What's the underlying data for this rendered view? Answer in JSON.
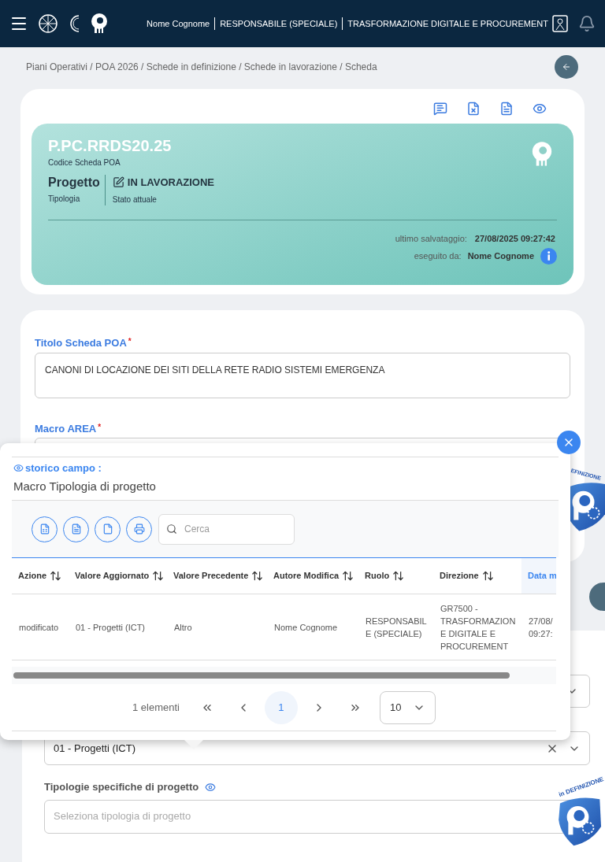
{
  "header": {
    "user": "Nome Cognome",
    "role": "RESPONSABILE (SPECIALE)",
    "department": "TRASFORMAZIONE DIGITALE E PROCUREMENT"
  },
  "breadcrumb": "Piani Operativi / POA 2026 / Schede in definizione / Schede in lavorazione / Scheda",
  "summary": {
    "code": "P.PC.RRDS20.25",
    "code_label": "Codice Scheda POA",
    "type": "Progetto",
    "type_label": "Tipologia",
    "status": "IN LAVORAZIONE",
    "status_label": "Stato attuale",
    "saved_label": "ultimo salvataggio:",
    "saved_value": "27/08/2025 09:27:42",
    "by_label": "eseguito da:",
    "by_value": "Nome Cognome"
  },
  "form": {
    "title_field": {
      "label": "Titolo Scheda POA",
      "required_mark": "*",
      "value": "CANONI DI LOCAZIONE DEI SITI DELLA RETE RADIO SISTEMI EMERGENZA"
    },
    "macro_area": {
      "label": "Macro AREA",
      "required_mark": "*"
    },
    "macro_tipologia": {
      "value": "01 - Progetti (ICT)"
    },
    "tipologie": {
      "label": "Tipologie specifiche di progetto",
      "placeholder": "Seleziona tipologia di progetto"
    }
  },
  "history_popup": {
    "heading": "storico campo :",
    "field": "Macro Tipologia di progetto",
    "search_placeholder": "Cerca",
    "columns": [
      {
        "label": "Azione",
        "highlighted": false
      },
      {
        "label": "Valore Aggiornato",
        "highlighted": false
      },
      {
        "label": "Valore Precedente",
        "highlighted": false
      },
      {
        "label": "Autore Modifica",
        "highlighted": false
      },
      {
        "label": "Ruolo",
        "highlighted": false
      },
      {
        "label": "Direzione",
        "highlighted": false
      },
      {
        "label": "Data m",
        "highlighted": true
      }
    ],
    "rows": [
      [
        "modificato",
        "01 - Progetti (ICT)",
        "Altro",
        "Nome Cognome",
        "RESPONSABILE (SPECIALE)",
        "GR7500 - TRASFORMAZIONE DIGITALE E PROCUREMENT",
        "27/08/ 09:27:"
      ]
    ],
    "count": "1 elementi",
    "pages": [
      {
        "label": "1",
        "selected": true
      }
    ],
    "page_size": "10"
  },
  "stamps": [
    {
      "text": "EFINIZIONE"
    },
    {
      "text": "in DEFINIZIONE"
    }
  ]
}
